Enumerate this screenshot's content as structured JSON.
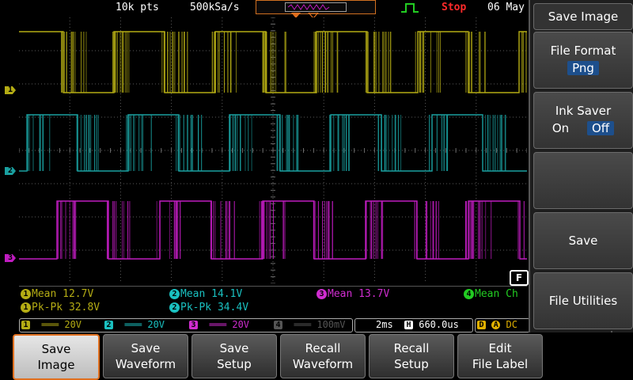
{
  "top": {
    "record_length": "10k pts",
    "sample_rate": "500kSa/s",
    "run_state": "Stop",
    "date": "06 May"
  },
  "colors": {
    "ch1": "#b4ac14",
    "ch2": "#1aa0a0",
    "ch3": "#c01cc0",
    "ch4": "#22cc22",
    "stop": "#ff2a2a",
    "accent": "#e07020",
    "pill": "#1d4f8c"
  },
  "channels": {
    "ch1_marker": "1",
    "ch2_marker": "2",
    "ch3_marker": "3"
  },
  "measurements": {
    "ch1_mean": "Mean 12.7V",
    "ch1_pkpk": "Pk-Pk 32.8V",
    "ch2_mean": "Mean 14.1V",
    "ch2_pkpk": "Pk-Pk 34.4V",
    "ch3_mean": "Mean 13.7V",
    "ch4_mean": "Mean Ch"
  },
  "status_bar": {
    "ch1_scale": "20V",
    "ch2_scale": "20V",
    "ch3_scale": "20V",
    "ch4_scale": "100mV",
    "timebase": "2ms",
    "horizontal_pos": "660.0us",
    "trigger_source": "A",
    "coupling": "DC"
  },
  "side_menu": {
    "title": "Save Image",
    "file_format_label": "File Format",
    "file_format_value": "Png",
    "ink_saver_label": "Ink Saver",
    "ink_saver_on": "On",
    "ink_saver_off": "Off",
    "save_label": "Save",
    "file_utilities_label": "File Utilities"
  },
  "softkeys": [
    {
      "line1": "Save",
      "line2": "Image"
    },
    {
      "line1": "Save",
      "line2": "Waveform"
    },
    {
      "line1": "Save",
      "line2": "Setup"
    },
    {
      "line1": "Recall",
      "line2": "Waveform"
    },
    {
      "line1": "Recall",
      "line2": "Setup"
    },
    {
      "line1": "Edit",
      "line2": "File Label"
    }
  ],
  "badge": "F"
}
